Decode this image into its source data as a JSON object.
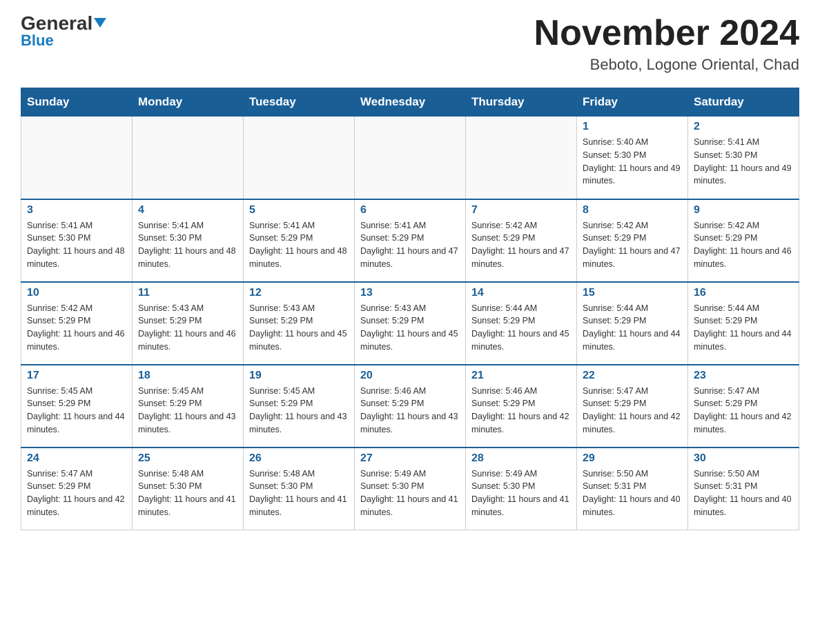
{
  "logo": {
    "general": "General",
    "blue": "Blue",
    "triangle": "▼"
  },
  "header": {
    "month_year": "November 2024",
    "location": "Beboto, Logone Oriental, Chad"
  },
  "weekdays": [
    "Sunday",
    "Monday",
    "Tuesday",
    "Wednesday",
    "Thursday",
    "Friday",
    "Saturday"
  ],
  "weeks": [
    [
      {
        "day": "",
        "info": ""
      },
      {
        "day": "",
        "info": ""
      },
      {
        "day": "",
        "info": ""
      },
      {
        "day": "",
        "info": ""
      },
      {
        "day": "",
        "info": ""
      },
      {
        "day": "1",
        "info": "Sunrise: 5:40 AM\nSunset: 5:30 PM\nDaylight: 11 hours and 49 minutes."
      },
      {
        "day": "2",
        "info": "Sunrise: 5:41 AM\nSunset: 5:30 PM\nDaylight: 11 hours and 49 minutes."
      }
    ],
    [
      {
        "day": "3",
        "info": "Sunrise: 5:41 AM\nSunset: 5:30 PM\nDaylight: 11 hours and 48 minutes."
      },
      {
        "day": "4",
        "info": "Sunrise: 5:41 AM\nSunset: 5:30 PM\nDaylight: 11 hours and 48 minutes."
      },
      {
        "day": "5",
        "info": "Sunrise: 5:41 AM\nSunset: 5:29 PM\nDaylight: 11 hours and 48 minutes."
      },
      {
        "day": "6",
        "info": "Sunrise: 5:41 AM\nSunset: 5:29 PM\nDaylight: 11 hours and 47 minutes."
      },
      {
        "day": "7",
        "info": "Sunrise: 5:42 AM\nSunset: 5:29 PM\nDaylight: 11 hours and 47 minutes."
      },
      {
        "day": "8",
        "info": "Sunrise: 5:42 AM\nSunset: 5:29 PM\nDaylight: 11 hours and 47 minutes."
      },
      {
        "day": "9",
        "info": "Sunrise: 5:42 AM\nSunset: 5:29 PM\nDaylight: 11 hours and 46 minutes."
      }
    ],
    [
      {
        "day": "10",
        "info": "Sunrise: 5:42 AM\nSunset: 5:29 PM\nDaylight: 11 hours and 46 minutes."
      },
      {
        "day": "11",
        "info": "Sunrise: 5:43 AM\nSunset: 5:29 PM\nDaylight: 11 hours and 46 minutes."
      },
      {
        "day": "12",
        "info": "Sunrise: 5:43 AM\nSunset: 5:29 PM\nDaylight: 11 hours and 45 minutes."
      },
      {
        "day": "13",
        "info": "Sunrise: 5:43 AM\nSunset: 5:29 PM\nDaylight: 11 hours and 45 minutes."
      },
      {
        "day": "14",
        "info": "Sunrise: 5:44 AM\nSunset: 5:29 PM\nDaylight: 11 hours and 45 minutes."
      },
      {
        "day": "15",
        "info": "Sunrise: 5:44 AM\nSunset: 5:29 PM\nDaylight: 11 hours and 44 minutes."
      },
      {
        "day": "16",
        "info": "Sunrise: 5:44 AM\nSunset: 5:29 PM\nDaylight: 11 hours and 44 minutes."
      }
    ],
    [
      {
        "day": "17",
        "info": "Sunrise: 5:45 AM\nSunset: 5:29 PM\nDaylight: 11 hours and 44 minutes."
      },
      {
        "day": "18",
        "info": "Sunrise: 5:45 AM\nSunset: 5:29 PM\nDaylight: 11 hours and 43 minutes."
      },
      {
        "day": "19",
        "info": "Sunrise: 5:45 AM\nSunset: 5:29 PM\nDaylight: 11 hours and 43 minutes."
      },
      {
        "day": "20",
        "info": "Sunrise: 5:46 AM\nSunset: 5:29 PM\nDaylight: 11 hours and 43 minutes."
      },
      {
        "day": "21",
        "info": "Sunrise: 5:46 AM\nSunset: 5:29 PM\nDaylight: 11 hours and 42 minutes."
      },
      {
        "day": "22",
        "info": "Sunrise: 5:47 AM\nSunset: 5:29 PM\nDaylight: 11 hours and 42 minutes."
      },
      {
        "day": "23",
        "info": "Sunrise: 5:47 AM\nSunset: 5:29 PM\nDaylight: 11 hours and 42 minutes."
      }
    ],
    [
      {
        "day": "24",
        "info": "Sunrise: 5:47 AM\nSunset: 5:29 PM\nDaylight: 11 hours and 42 minutes."
      },
      {
        "day": "25",
        "info": "Sunrise: 5:48 AM\nSunset: 5:30 PM\nDaylight: 11 hours and 41 minutes."
      },
      {
        "day": "26",
        "info": "Sunrise: 5:48 AM\nSunset: 5:30 PM\nDaylight: 11 hours and 41 minutes."
      },
      {
        "day": "27",
        "info": "Sunrise: 5:49 AM\nSunset: 5:30 PM\nDaylight: 11 hours and 41 minutes."
      },
      {
        "day": "28",
        "info": "Sunrise: 5:49 AM\nSunset: 5:30 PM\nDaylight: 11 hours and 41 minutes."
      },
      {
        "day": "29",
        "info": "Sunrise: 5:50 AM\nSunset: 5:31 PM\nDaylight: 11 hours and 40 minutes."
      },
      {
        "day": "30",
        "info": "Sunrise: 5:50 AM\nSunset: 5:31 PM\nDaylight: 11 hours and 40 minutes."
      }
    ]
  ]
}
